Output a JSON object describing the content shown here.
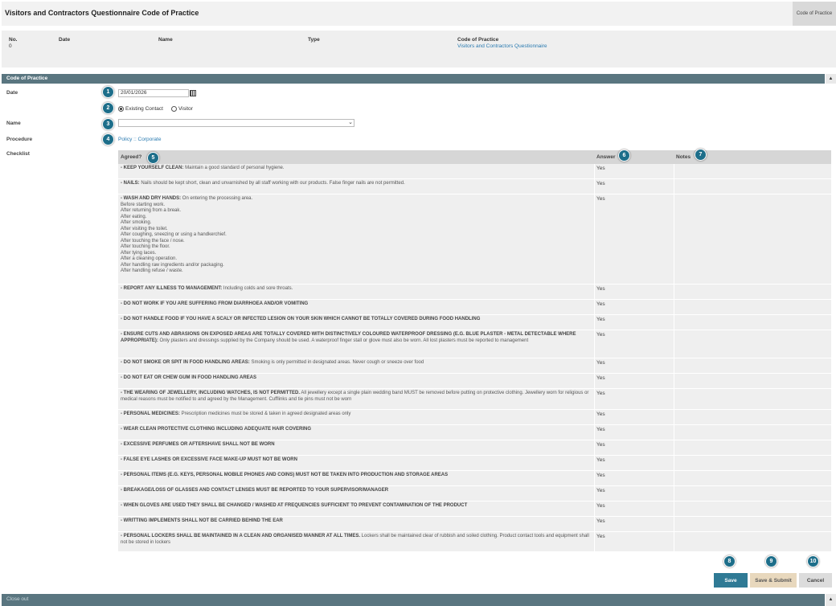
{
  "window": {
    "title": "Visitors and Contractors Questionnaire Code of Practice",
    "tab_label": "Code of Practice"
  },
  "summary": {
    "no_header": "No.",
    "no_value": "0",
    "date_header": "Date",
    "name_header": "Name",
    "type_header": "Type",
    "cop_header": "Code of Practice",
    "cop_value": "Visitors and Contractors Questionnaire"
  },
  "section": {
    "title": "Code of Practice",
    "collapse_glyph": "▲"
  },
  "form": {
    "date_label": "Date",
    "date_value": "20/01/2026",
    "contact_options": [
      "Existing Contact",
      "Visitor"
    ],
    "contact_selected": "Existing Contact",
    "name_label": "Name",
    "name_value": "",
    "procedure_label": "Procedure",
    "procedure_link": "Policy :: Corporate",
    "checklist_label": "Checklist"
  },
  "table": {
    "headers": [
      "Agreed?",
      "Answer",
      "Notes"
    ],
    "rows": [
      {
        "title": "- KEEP YOURSELF CLEAN:",
        "text": " Maintain a good standard of personal hygiene.",
        "answer": "Yes"
      },
      {
        "title": "- NAILS:",
        "text": " Nails should be kept short, clean and unvarnished by all staff working with our products. False finger nails are not permitted.",
        "answer": "Yes"
      },
      {
        "title": "- WASH AND DRY HANDS:",
        "text": " On entering the processing area.\nBefore starting work.\nAfter returning from a break.\nAfter eating.\nAfter smoking.\nAfter visiting the toilet.\nAfter coughing, sneezing or using a handkerchief.\nAfter touching the face / nose.\nAfter touching the floor.\nAfter tying laces.\nAfter a cleaning operation.\nAfter handling raw ingredients and/or packaging.\nAfter handling refuse / waste.",
        "answer": "Yes"
      },
      {
        "title": "- REPORT ANY ILLNESS TO MANAGEMENT:",
        "text": " Including colds and sore throats.",
        "answer": "Yes"
      },
      {
        "title": "- DO NOT WORK IF YOU ARE SUFFERING FROM DIARRHOEA AND/OR VOMITING",
        "text": "",
        "answer": "Yes"
      },
      {
        "title": "- DO NOT HANDLE FOOD IF YOU HAVE A SCALY OR INFECTED LESION ON YOUR SKIN WHICH CANNOT BE TOTALLY COVERED DURING FOOD HANDLING",
        "text": "",
        "answer": "Yes"
      },
      {
        "title": "- ENSURE CUTS AND ABRASIONS ON EXPOSED AREAS ARE TOTALLY COVERED WITH DISTINCTIVELY COLOURED WATERPROOF DRESSING (E.G. BLUE PLASTER - METAL DETECTABLE WHERE APPROPRIATE):",
        "text": " Only plasters and dressings supplied by the Company should be used. A waterproof finger stall or glove must also be worn. All lost plasters must be reported to management",
        "answer": "Yes"
      },
      {
        "title": "- DO NOT SMOKE OR SPIT IN FOOD HANDLING AREAS:",
        "text": " Smoking is only permitted in designated areas. Never cough or sneeze over food",
        "answer": "Yes"
      },
      {
        "title": "- DO NOT EAT OR CHEW GUM IN FOOD HANDLING AREAS",
        "text": "",
        "answer": "Yes"
      },
      {
        "title": "- THE WEARING OF JEWELLERY, INCLUDING WATCHES, IS NOT PERMITTED.",
        "text": " All jewellery except a single plain wedding band MUST be removed before putting on protective clothing. Jewellery worn for religious or medical reasons must be notified to and agreed by the Management. Cufflinks and tie pins must not be worn",
        "answer": "Yes"
      },
      {
        "title": "- PERSONAL MEDICINES:",
        "text": " Prescription medicines must be stored & taken in agreed designated areas only",
        "answer": "Yes"
      },
      {
        "title": "- WEAR CLEAN PROTECTIVE CLOTHING INCLUDING ADEQUATE HAIR COVERING",
        "text": "",
        "answer": "Yes"
      },
      {
        "title": "- EXCESSIVE PERFUMES OR AFTERSHAVE SHALL NOT BE WORN",
        "text": "",
        "answer": "Yes"
      },
      {
        "title": "- FALSE EYE LASHES OR EXCESSIVE FACE MAKE-UP MUST NOT BE WORN",
        "text": "",
        "answer": "Yes"
      },
      {
        "title": "- PERSONAL ITEMS (E.G. KEYS, PERSONAL MOBILE PHONES AND COINS) MUST NOT BE TAKEN INTO PRODUCTION AND STORAGE AREAS",
        "text": "",
        "answer": "Yes"
      },
      {
        "title": "- BREAKAGE/LOSS OF GLASSES AND CONTACT LENSES MUST BE REPORTED TO YOUR SUPERVISOR/MANAGER",
        "text": "",
        "answer": "Yes"
      },
      {
        "title": "- WHEN GLOVES ARE USED THEY SHALL BE CHANGED / WASHED AT FREQUENCIES SUFFICIENT TO PREVENT CONTAMINATION OF THE PRODUCT",
        "text": "",
        "answer": "Yes"
      },
      {
        "title": "- WRITTING IMPLEMENTS SHALL NOT BE CARRIED BEHIND THE EAR",
        "text": "",
        "answer": "Yes"
      },
      {
        "title": "- PERSONAL LOCKERS SHALL BE MAINTAINED IN A CLEAN AND ORGANISED MANNER AT ALL TIMES.",
        "text": " Lockers shall be maintained clear of rubbish and soiled clothing. Product contact tools and equipment shall not be stored in lockers",
        "answer": "Yes"
      }
    ]
  },
  "buttons": {
    "save": "Save",
    "save_submit": "Save & Submit",
    "cancel": "Cancel"
  },
  "badges": [
    "1",
    "2",
    "3",
    "4",
    "5",
    "6",
    "7",
    "8",
    "9",
    "10"
  ],
  "bottom": {
    "label": "Close out",
    "collapse_glyph": "▲"
  },
  "colors": {
    "section_bar": "#5a7680",
    "badge": "#1d6e8a",
    "save_button": "#2f7a95",
    "submit_button": "#e8d8bd",
    "link": "#2a7ab0"
  },
  "icons": {
    "calendar": "calendar-icon",
    "dropdown": "chevron-down-icon"
  }
}
